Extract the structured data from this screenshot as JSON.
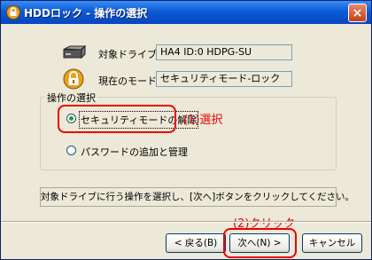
{
  "window": {
    "title": "HDDロック - 操作の選択",
    "close_label": "×"
  },
  "target": {
    "label": "対象ドライブ：",
    "value": "HA4 ID:0 HDPG-SU"
  },
  "mode": {
    "label": "現在のモード：",
    "value": "セキュリティモード-ロック"
  },
  "operation": {
    "group_label": "操作の選択",
    "options": [
      {
        "label": "セキュリティモードの解除",
        "selected": true
      },
      {
        "label": "パスワードの追加と管理",
        "selected": false
      }
    ]
  },
  "annotations": {
    "step1": "(1)選択",
    "step2": "(2)クリック"
  },
  "instruction": "対象ドライブに行う操作を選択し、[次へ]ボタンをクリックしてください。",
  "buttons": {
    "back": "< 戻る(B)",
    "next": "次へ(N) >",
    "cancel": "キャンセル"
  },
  "colors": {
    "titlebar": "#0b5bd6",
    "annotation": "#e00000"
  }
}
